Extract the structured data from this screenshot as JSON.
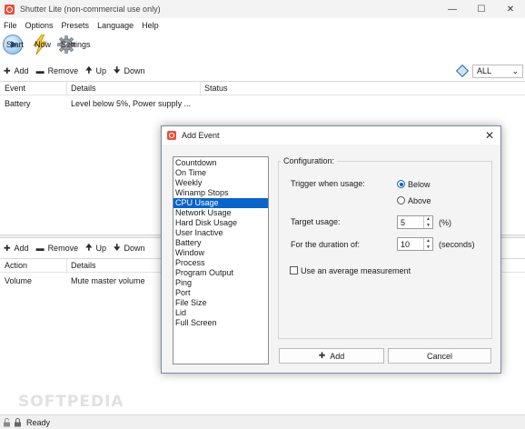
{
  "window": {
    "title": "Shutter Lite (non-commercial use only)"
  },
  "menu": [
    "File",
    "Options",
    "Presets",
    "Language",
    "Help"
  ],
  "toolbar": {
    "start": "Start",
    "now": "Now",
    "settings": "Settings"
  },
  "events_toolbar": {
    "add": "Add",
    "remove": "Remove",
    "up": "Up",
    "down": "Down",
    "filter_value": "ALL"
  },
  "events_table": {
    "columns": [
      "Event",
      "Details",
      "Status"
    ],
    "rows": [
      {
        "event": "Battery",
        "details": "Level below 5%, Power supply ...",
        "status": ""
      }
    ]
  },
  "actions_toolbar": {
    "add": "Add",
    "remove": "Remove",
    "up": "Up",
    "down": "Down"
  },
  "actions_table": {
    "columns": [
      "Action",
      "Details"
    ],
    "rows": [
      {
        "action": "Volume",
        "details": "Mute master volume"
      }
    ]
  },
  "status": {
    "text": "Ready"
  },
  "watermark": "SOFTPEDIA",
  "dialog": {
    "title": "Add Event",
    "event_types": [
      "Countdown",
      "On Time",
      "Weekly",
      "Winamp Stops",
      "CPU Usage",
      "Network Usage",
      "Hard Disk Usage",
      "User Inactive",
      "Battery",
      "Window",
      "Process",
      "Program Output",
      "Ping",
      "Port",
      "File Size",
      "Lid",
      "Full Screen"
    ],
    "selected_event": "CPU Usage",
    "config": {
      "legend": "Configuration:",
      "trigger_label": "Trigger when usage:",
      "option_below": "Below",
      "option_above": "Above",
      "selected_option": "Below",
      "target_label": "Target usage:",
      "target_value": "5",
      "target_unit": "(%)",
      "duration_label": "For the duration of:",
      "duration_value": "10",
      "duration_unit": "(seconds)",
      "avg_label": "Use an average measurement",
      "avg_checked": false
    },
    "add_button": "Add",
    "cancel_button": "Cancel"
  }
}
